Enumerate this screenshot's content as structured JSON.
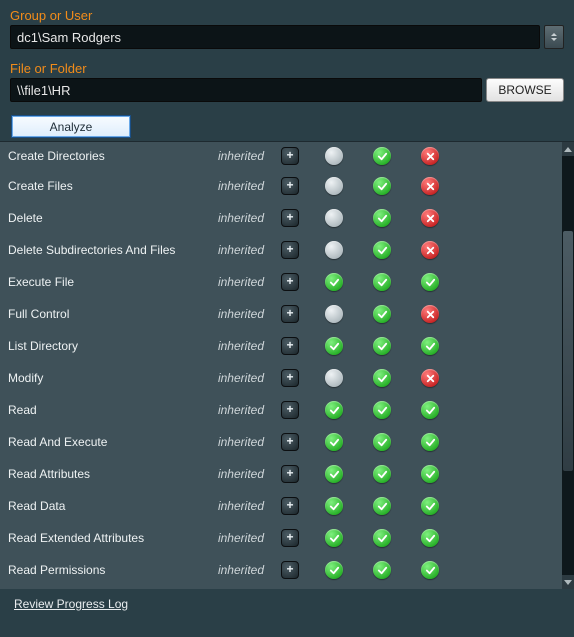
{
  "labels": {
    "group_or_user": "Group or User",
    "file_or_folder": "File or Folder",
    "browse": "BROWSE",
    "analyze": "Analyze",
    "review_log": "Review Progress Log",
    "inherited": "inherited"
  },
  "inputs": {
    "group_user_value": "dc1\\Sam Rodgers",
    "path_value": "\\\\file1\\HR"
  },
  "icons": {
    "check": "check-icon",
    "cross": "cross-icon",
    "neutral": "neutral-icon",
    "plus": "plus-icon"
  },
  "permissions": [
    {
      "name": "Create Directories",
      "inh": true,
      "c1": "nt",
      "c2": "ok",
      "c3": "no",
      "first": true
    },
    {
      "name": "Create Files",
      "inh": true,
      "c1": "nt",
      "c2": "ok",
      "c3": "no"
    },
    {
      "name": "Delete",
      "inh": true,
      "c1": "nt",
      "c2": "ok",
      "c3": "no"
    },
    {
      "name": "Delete Subdirectories And Files",
      "inh": true,
      "c1": "nt",
      "c2": "ok",
      "c3": "no"
    },
    {
      "name": "Execute File",
      "inh": true,
      "c1": "ok",
      "c2": "ok",
      "c3": "ok"
    },
    {
      "name": "Full Control",
      "inh": true,
      "c1": "nt",
      "c2": "ok",
      "c3": "no"
    },
    {
      "name": "List Directory",
      "inh": true,
      "c1": "ok",
      "c2": "ok",
      "c3": "ok"
    },
    {
      "name": "Modify",
      "inh": true,
      "c1": "nt",
      "c2": "ok",
      "c3": "no"
    },
    {
      "name": "Read",
      "inh": true,
      "c1": "ok",
      "c2": "ok",
      "c3": "ok"
    },
    {
      "name": "Read And Execute",
      "inh": true,
      "c1": "ok",
      "c2": "ok",
      "c3": "ok"
    },
    {
      "name": "Read Attributes",
      "inh": true,
      "c1": "ok",
      "c2": "ok",
      "c3": "ok"
    },
    {
      "name": "Read Data",
      "inh": true,
      "c1": "ok",
      "c2": "ok",
      "c3": "ok"
    },
    {
      "name": "Read Extended Attributes",
      "inh": true,
      "c1": "ok",
      "c2": "ok",
      "c3": "ok"
    },
    {
      "name": "Read Permissions",
      "inh": true,
      "c1": "ok",
      "c2": "ok",
      "c3": "ok"
    }
  ]
}
